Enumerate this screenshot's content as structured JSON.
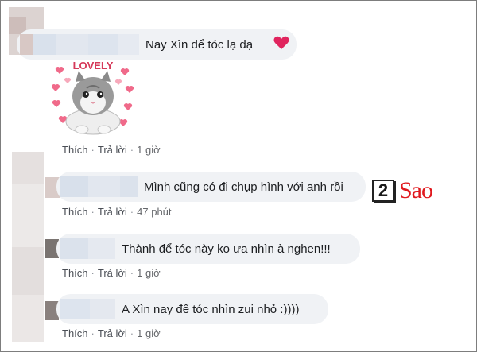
{
  "comments": [
    {
      "text": "Nay Xìn để tóc lạ dạ",
      "has_heart": true,
      "sticker": {
        "caption": "LOVELY"
      },
      "actions": {
        "like": "Thích",
        "reply": "Trả lời",
        "time": "1 giờ"
      }
    },
    {
      "text": "Mình cũng có đi chụp hình với anh rồi",
      "actions": {
        "like": "Thích",
        "reply": "Trả lời",
        "time": "47 phút"
      }
    },
    {
      "text": "Thành để tóc này ko ưa nhìn à nghen!!!",
      "actions": {
        "like": "Thích",
        "reply": "Trả lời",
        "time": "1 giờ"
      }
    },
    {
      "text": "A Xìn nay để tóc nhìn zui nhỏ :))))",
      "actions": {
        "like": "Thích",
        "reply": "Trả lời",
        "time": "1 giờ"
      }
    }
  ],
  "separator": "·",
  "watermark": {
    "digit": "2",
    "word": "Sao"
  },
  "colors": {
    "bubble_bg": "#f0f2f5",
    "text": "#1c1e21",
    "action_text": "#4b4f56",
    "heart": "#e0245e",
    "watermark_red": "#e0191e"
  }
}
